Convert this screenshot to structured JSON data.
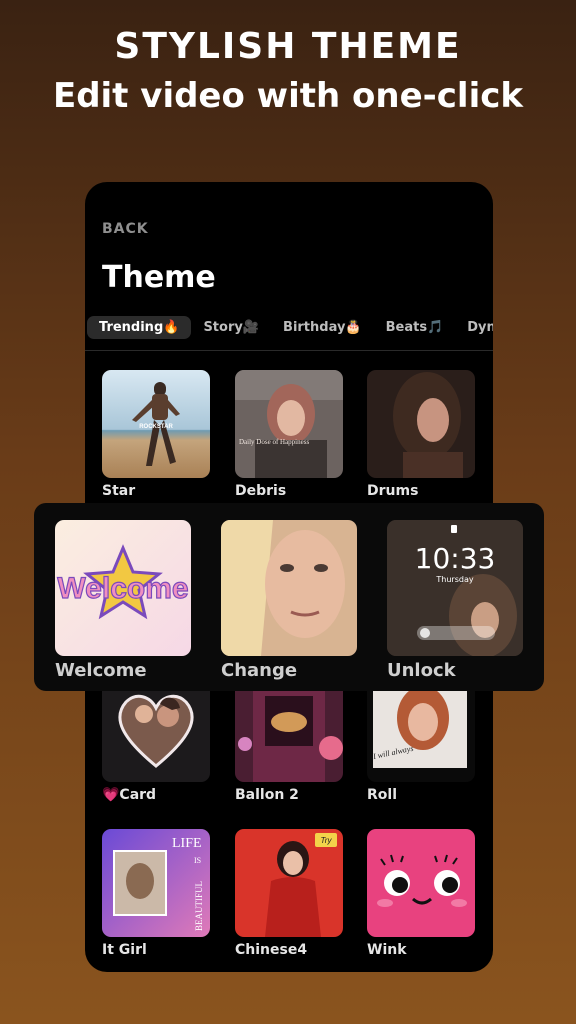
{
  "promo": {
    "title": "STYLISH THEME",
    "subtitle": "Edit video with one-click"
  },
  "screen": {
    "back_label": "BACK",
    "title": "Theme"
  },
  "tabs": [
    {
      "label": "Trending🔥",
      "active": true
    },
    {
      "label": "Story🎥",
      "active": false
    },
    {
      "label": "Birthday🎂",
      "active": false
    },
    {
      "label": "Beats🎵",
      "active": false
    },
    {
      "label": "Dyna",
      "active": false
    }
  ],
  "grid": [
    {
      "label": "Star"
    },
    {
      "label": "Debris"
    },
    {
      "label": "Drums"
    },
    {
      "label": "💗Card"
    },
    {
      "label": "Ballon 2"
    },
    {
      "label": "Roll"
    },
    {
      "label": "It Girl"
    },
    {
      "label": "Chinese4"
    },
    {
      "label": "Wink"
    }
  ],
  "featured": [
    {
      "label": "Welcome",
      "art_text": "Welcome"
    },
    {
      "label": "Change"
    },
    {
      "label": "Unlock",
      "time": "10:33",
      "day": "Thursday"
    }
  ],
  "thumb_text": {
    "star": "ROCKSTAR",
    "debris": "Daily  Dose of Happiness",
    "roll": "I will always",
    "itgirl_life": "LIFE",
    "itgirl_is": "IS",
    "itgirl_beautiful": "BEAUTIFUL",
    "chinese_badge": "Try"
  },
  "colors": {
    "background_top": "#3a2212",
    "background_bottom": "#8a541e",
    "phone": "#000000",
    "active_tab": "#2b2b2b",
    "wink_pink": "#e8427f"
  }
}
